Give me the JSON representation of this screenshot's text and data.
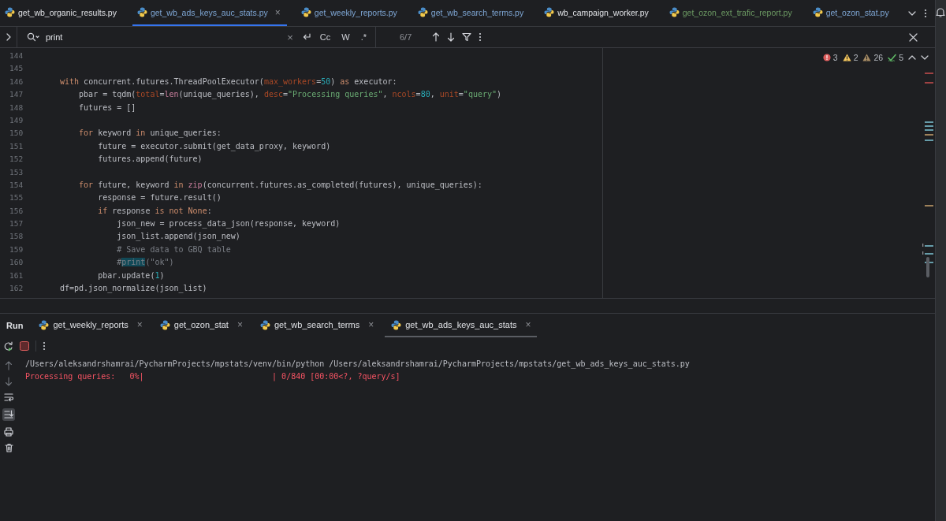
{
  "tabs": [
    {
      "label": "get_wb_organic_results.py",
      "kind": "unchanged",
      "selected": false
    },
    {
      "label": "get_wb_ads_keys_auc_stats.py",
      "kind": "modified",
      "selected": true,
      "close": "×"
    },
    {
      "label": "get_weekly_reports.py",
      "kind": "modified",
      "selected": false
    },
    {
      "label": "get_wb_search_terms.py",
      "kind": "modified",
      "selected": false
    },
    {
      "label": "wb_campaign_worker.py",
      "kind": "unchanged",
      "selected": false
    },
    {
      "label": "get_ozon_ext_trafic_report.py",
      "kind": "added",
      "selected": false
    },
    {
      "label": "get_ozon_stat.py",
      "kind": "modified",
      "selected": false
    }
  ],
  "find": {
    "value": "print",
    "clear": "×",
    "options": [
      "Cc",
      "W",
      ".*"
    ],
    "result_count": "6/7"
  },
  "inspections": [
    {
      "kind": "error",
      "count": "3"
    },
    {
      "kind": "warning",
      "count": "2"
    },
    {
      "kind": "weak",
      "count": "26"
    },
    {
      "kind": "typo",
      "count": "5"
    }
  ],
  "editor": {
    "lines": [
      {
        "number": "144"
      },
      {
        "number": "145"
      },
      {
        "number": "146",
        "tokens": [
          {
            "kind": "keyword",
            "text": "with"
          },
          {
            "kind": "plain",
            "text": " concurrent.futures.ThreadPoolExecutor("
          },
          {
            "kind": "param",
            "text": "max_workers"
          },
          {
            "kind": "plain",
            "text": "="
          },
          {
            "kind": "number",
            "text": "50"
          },
          {
            "kind": "plain",
            "text": ") "
          },
          {
            "kind": "keyword",
            "text": "as"
          },
          {
            "kind": "plain",
            "text": " executor:"
          }
        ]
      },
      {
        "number": "147",
        "tokens": [
          {
            "kind": "plain",
            "text": "    pbar = tqdm("
          },
          {
            "kind": "param",
            "text": "total"
          },
          {
            "kind": "plain",
            "text": "="
          },
          {
            "kind": "builtin",
            "text": "len"
          },
          {
            "kind": "plain",
            "text": "(unique_queries), "
          },
          {
            "kind": "param",
            "text": "desc"
          },
          {
            "kind": "plain",
            "text": "="
          },
          {
            "kind": "string",
            "text": "\"Processing queries\""
          },
          {
            "kind": "plain",
            "text": ", "
          },
          {
            "kind": "param",
            "text": "ncols"
          },
          {
            "kind": "plain",
            "text": "="
          },
          {
            "kind": "number",
            "text": "80"
          },
          {
            "kind": "plain",
            "text": ", "
          },
          {
            "kind": "param",
            "text": "unit"
          },
          {
            "kind": "plain",
            "text": "="
          },
          {
            "kind": "string",
            "text": "\"query\""
          },
          {
            "kind": "plain",
            "text": ")"
          }
        ]
      },
      {
        "number": "148",
        "tokens": [
          {
            "kind": "plain",
            "text": "    futures = []"
          }
        ]
      },
      {
        "number": "149"
      },
      {
        "number": "150",
        "tokens": [
          {
            "kind": "keyword",
            "text": "    for"
          },
          {
            "kind": "plain",
            "text": " keyword "
          },
          {
            "kind": "keyword",
            "text": "in"
          },
          {
            "kind": "plain",
            "text": " unique_queries:"
          }
        ]
      },
      {
        "number": "151",
        "tokens": [
          {
            "kind": "plain",
            "text": "        future = executor.submit(get_data_proxy, keyword)"
          }
        ]
      },
      {
        "number": "152",
        "tokens": [
          {
            "kind": "plain",
            "text": "        futures.append(future)"
          }
        ]
      },
      {
        "number": "153"
      },
      {
        "number": "154",
        "tokens": [
          {
            "kind": "keyword",
            "text": "    for"
          },
          {
            "kind": "plain",
            "text": " future, keyword "
          },
          {
            "kind": "keyword",
            "text": "in"
          },
          {
            "kind": "builtin",
            "text": " zip"
          },
          {
            "kind": "plain",
            "text": "(concurrent.futures.as_completed(futures), unique_queries):"
          }
        ]
      },
      {
        "number": "155",
        "tokens": [
          {
            "kind": "plain",
            "text": "        response = future.result()"
          }
        ]
      },
      {
        "number": "156",
        "tokens": [
          {
            "kind": "keyword",
            "text": "        if"
          },
          {
            "kind": "plain",
            "text": " response "
          },
          {
            "kind": "keyword",
            "text": "is not None"
          },
          {
            "kind": "plain",
            "text": ":"
          }
        ]
      },
      {
        "number": "157",
        "tokens": [
          {
            "kind": "plain",
            "text": "            json_new = process_data_json(response, keyword)"
          }
        ]
      },
      {
        "number": "158",
        "tokens": [
          {
            "kind": "plain",
            "text": "            json_list.append(json_new)"
          }
        ]
      },
      {
        "number": "159",
        "tokens": [
          {
            "kind": "comment",
            "text": "            # Save data to GBQ table"
          }
        ]
      },
      {
        "number": "160",
        "tokens": [
          {
            "kind": "comment",
            "text": "            #"
          },
          {
            "kind": "match",
            "text": "print"
          },
          {
            "kind": "comment",
            "text": "(\"ok\")"
          }
        ]
      },
      {
        "number": "161",
        "tokens": [
          {
            "kind": "plain",
            "text": "        pbar.update("
          },
          {
            "kind": "number",
            "text": "1"
          },
          {
            "kind": "plain",
            "text": ")"
          }
        ]
      },
      {
        "number": "162",
        "tokens": [
          {
            "kind": "plain",
            "text": "df=pd.json_normalize(json_list)"
          }
        ]
      }
    ]
  },
  "run_panel": {
    "title": "Run",
    "tabs": [
      {
        "label": "get_weekly_reports",
        "selected": false,
        "close": "×"
      },
      {
        "label": "get_ozon_stat",
        "selected": false,
        "close": "×"
      },
      {
        "label": "get_wb_search_terms",
        "selected": false,
        "close": "×"
      },
      {
        "label": "get_wb_ads_keys_auc_stats",
        "selected": true,
        "close": "×"
      }
    ],
    "console": [
      {
        "kind": "stdout",
        "text": "/Users/aleksandrshamrai/PycharmProjects/mpstats/venv/bin/python /Users/aleksandrshamrai/PycharmProjects/mpstats/get_wb_ads_keys_auc_stats.py"
      },
      {
        "kind": "stderr",
        "text": "Processing queries:   0%|                           | 0/840 [00:00<?, ?query/s]"
      }
    ]
  }
}
